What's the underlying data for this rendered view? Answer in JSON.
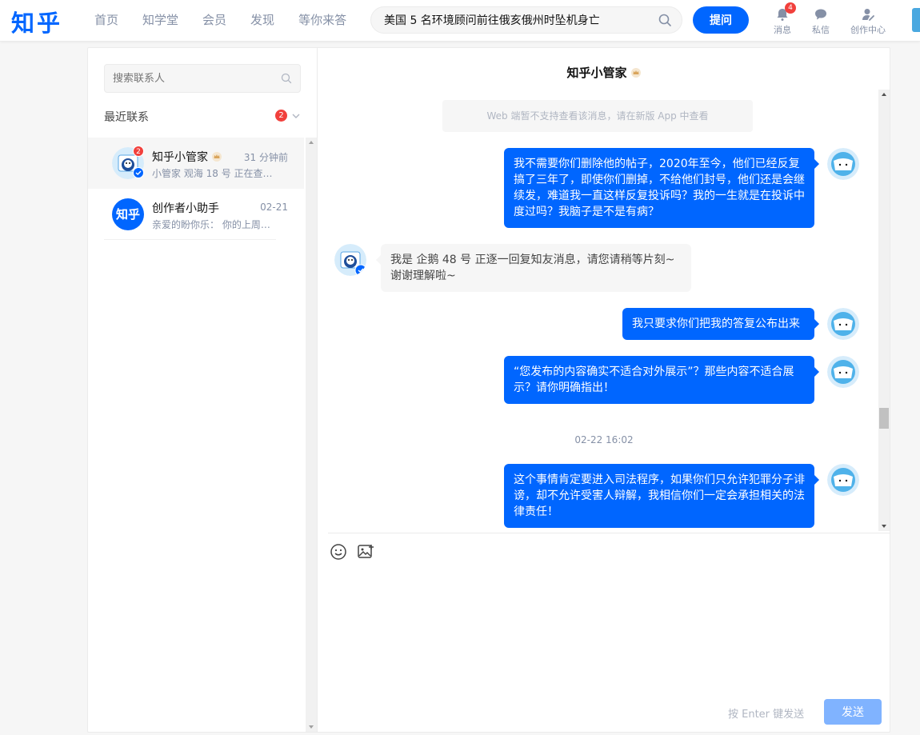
{
  "header": {
    "logo": "知乎",
    "nav": [
      "首页",
      "知学堂",
      "会员",
      "发现",
      "等你来答"
    ],
    "search_value": "美国 5 名环境顾问前往俄亥俄州时坠机身亡",
    "ask_label": "提问",
    "icons": [
      {
        "label": "消息",
        "badge": "4"
      },
      {
        "label": "私信",
        "badge": ""
      },
      {
        "label": "创作中心",
        "badge": ""
      }
    ]
  },
  "sidebar": {
    "search_placeholder": "搜索联系人",
    "recent_label": "最近联系",
    "recent_badge": "2",
    "contacts": [
      {
        "name": "知乎小管家",
        "time": "31 分钟前",
        "preview": "小管家 观海 18 号 正在查…",
        "badge": "2"
      },
      {
        "name": "创作者小助手",
        "time": "02-21",
        "preview": "亲爱的盼你乐： 你的上周…",
        "avatar_text": "知乎"
      }
    ]
  },
  "chat": {
    "title": "知乎小管家",
    "notice": "Web 端暂不支持查看该消息，请在新版 App 中查看",
    "messages": [
      {
        "from": "me",
        "text": "我不需要你们删除他的帖子，2020年至今，他们已经反复搞了三年了，即使你们删掉，不给他们封号，他们还是会继续发，难道我一直这样反复投诉吗？我的一生就是在投诉中度过吗？我脑子是不是有病？"
      },
      {
        "from": "bot",
        "text": "我是 企鹅 48 号 正逐一回复知友消息，请您请稍等片刻~ 谢谢理解啦~"
      },
      {
        "from": "me",
        "text": "我只要求你们把我的答复公布出来"
      },
      {
        "from": "me",
        "text": "“您发布的内容确实不适合对外展示”？那些内容不适合展示？请你明确指出！"
      },
      {
        "from": "me",
        "text": "这个事情肯定要进入司法程序，如果你们只允许犯罪分子诽谤，却不允许受害人辩解，我相信你们一定会承担相关的法律责任！"
      }
    ],
    "timestamp": "02-22 16:02",
    "input": {
      "placeholder": "",
      "hint": "按 Enter 键发送",
      "send_label": "发送"
    }
  },
  "colors": {
    "brand": "#0066ff",
    "badge": "#f1403c",
    "send_disabled": "#80b3ff"
  }
}
